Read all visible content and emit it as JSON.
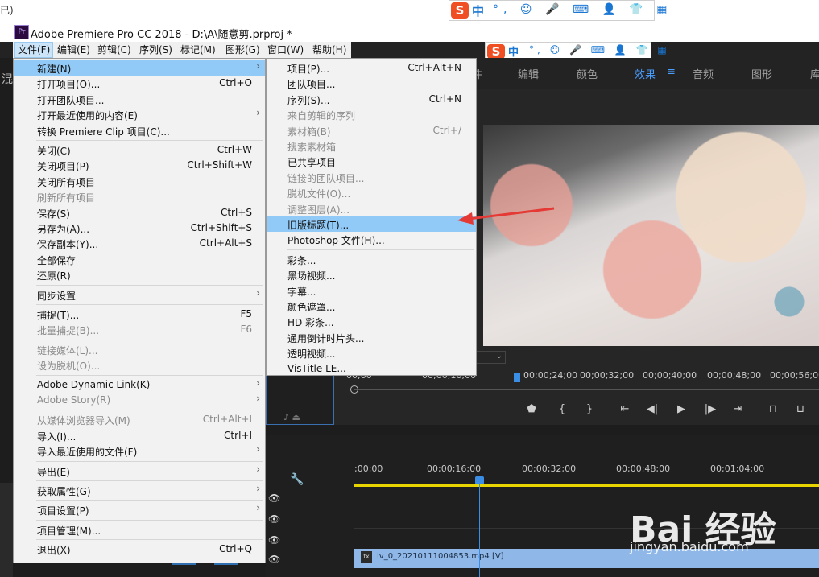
{
  "titlebar": {
    "app_title": "Adobe Premiere Pro CC 2018 - D:\\A\\随意剪.prproj *",
    "corner_text": "已)"
  },
  "menubar": [
    {
      "label": "文件(F)",
      "active": true
    },
    {
      "label": "编辑(E)"
    },
    {
      "label": "剪辑(C)"
    },
    {
      "label": "序列(S)"
    },
    {
      "label": "标记(M)"
    },
    {
      "label": "图形(G)"
    },
    {
      "label": "窗口(W)"
    },
    {
      "label": "帮助(H)"
    }
  ],
  "workspaces": {
    "items": [
      "编辑",
      "颜色",
      "效果",
      "音频",
      "图形",
      "库"
    ],
    "active": "效果",
    "menu_icon": "hamburger-icon",
    "left_partial": "混",
    "partial_tab": "件"
  },
  "ime": {
    "logo": "S",
    "mode": "中",
    "icons": "°, ☺ 🎤 ⌨ 👤 👕 ▦"
  },
  "file_menu": {
    "items": [
      {
        "label": "新建(N)",
        "shortcut": "",
        "arrow": true,
        "highlighted": true
      },
      {
        "label": "打开项目(O)...",
        "shortcut": "Ctrl+O"
      },
      {
        "label": "打开团队项目..."
      },
      {
        "label": "打开最近使用的内容(E)",
        "arrow": true
      },
      {
        "label": "转换 Premiere Clip 项目(C)..."
      },
      {
        "sep": true
      },
      {
        "label": "关闭(C)",
        "shortcut": "Ctrl+W"
      },
      {
        "label": "关闭项目(P)",
        "shortcut": "Ctrl+Shift+W"
      },
      {
        "label": "关闭所有项目"
      },
      {
        "label": "刷新所有项目",
        "disabled": true
      },
      {
        "label": "保存(S)",
        "shortcut": "Ctrl+S"
      },
      {
        "label": "另存为(A)...",
        "shortcut": "Ctrl+Shift+S"
      },
      {
        "label": "保存副本(Y)...",
        "shortcut": "Ctrl+Alt+S"
      },
      {
        "label": "全部保存"
      },
      {
        "label": "还原(R)"
      },
      {
        "sep": true
      },
      {
        "label": "同步设置",
        "arrow": true
      },
      {
        "sep": true
      },
      {
        "label": "捕捉(T)...",
        "shortcut": "F5"
      },
      {
        "label": "批量捕捉(B)...",
        "shortcut": "F6",
        "disabled": true
      },
      {
        "sep": true
      },
      {
        "label": "链接媒体(L)...",
        "disabled": true
      },
      {
        "label": "设为脱机(O)...",
        "disabled": true
      },
      {
        "sep": true
      },
      {
        "label": "Adobe Dynamic Link(K)",
        "arrow": true
      },
      {
        "label": "Adobe Story(R)",
        "arrow": true,
        "disabled": true
      },
      {
        "sep": true
      },
      {
        "label": "从媒体浏览器导入(M)",
        "shortcut": "Ctrl+Alt+I",
        "disabled": true
      },
      {
        "label": "导入(I)...",
        "shortcut": "Ctrl+I"
      },
      {
        "label": "导入最近使用的文件(F)",
        "arrow": true
      },
      {
        "sep": true
      },
      {
        "label": "导出(E)",
        "arrow": true
      },
      {
        "sep": true
      },
      {
        "label": "获取属性(G)",
        "arrow": true
      },
      {
        "sep": true
      },
      {
        "label": "项目设置(P)",
        "arrow": true
      },
      {
        "sep": true
      },
      {
        "label": "项目管理(M)..."
      },
      {
        "sep": true
      },
      {
        "label": "退出(X)",
        "shortcut": "Ctrl+Q"
      }
    ]
  },
  "new_submenu": {
    "items": [
      {
        "label": "项目(P)...",
        "shortcut": "Ctrl+Alt+N"
      },
      {
        "label": "团队项目..."
      },
      {
        "label": "序列(S)...",
        "shortcut": "Ctrl+N"
      },
      {
        "label": "来自剪辑的序列",
        "disabled": true
      },
      {
        "label": "素材箱(B)",
        "shortcut": "Ctrl+/",
        "disabled": true
      },
      {
        "label": "搜索素材箱",
        "disabled": true
      },
      {
        "label": "已共享项目"
      },
      {
        "label": "链接的团队项目...",
        "disabled": true
      },
      {
        "label": "脱机文件(O)...",
        "disabled": true
      },
      {
        "label": "调整图层(A)...",
        "disabled": true
      },
      {
        "label": "旧版标题(T)...",
        "highlighted": true
      },
      {
        "label": "Photoshop 文件(H)..."
      },
      {
        "sep": true
      },
      {
        "label": "彩条..."
      },
      {
        "label": "黑场视频..."
      },
      {
        "label": "字幕..."
      },
      {
        "label": "颜色遮罩..."
      },
      {
        "label": "HD 彩条..."
      },
      {
        "label": "通用倒计时片头..."
      },
      {
        "label": "透明视频..."
      },
      {
        "label": "VisTitle LE..."
      }
    ]
  },
  "program_ruler": [
    "00;00",
    "00;00;16;00",
    "00;00;24;00",
    "00;00;32;00",
    "00;00;40;00",
    "00;00;48;00",
    "00;00;56;00"
  ],
  "transport_icons": [
    "marker-icon",
    "in-point-icon",
    "out-point-icon",
    "go-to-in-icon",
    "step-back-icon",
    "play-icon",
    "step-forward-icon",
    "go-to-out-icon",
    "lift-icon",
    "extract-icon"
  ],
  "timeline_ruler": [
    ";00;00",
    "00;00;16;00",
    "00;00;32;00",
    "00;00;48;00",
    "00;01;04;00"
  ],
  "clip": {
    "name": "lv_0_20210111004853.mp4 [V]"
  },
  "watermark": {
    "logo": "Bai 经验",
    "url": "jingyan.baidu.com"
  },
  "colors": {
    "menu_highlight": "#91c9f7",
    "arrow": "#e53935",
    "clip": "#8fb8e8",
    "active_workspace": "#4a9eff"
  }
}
